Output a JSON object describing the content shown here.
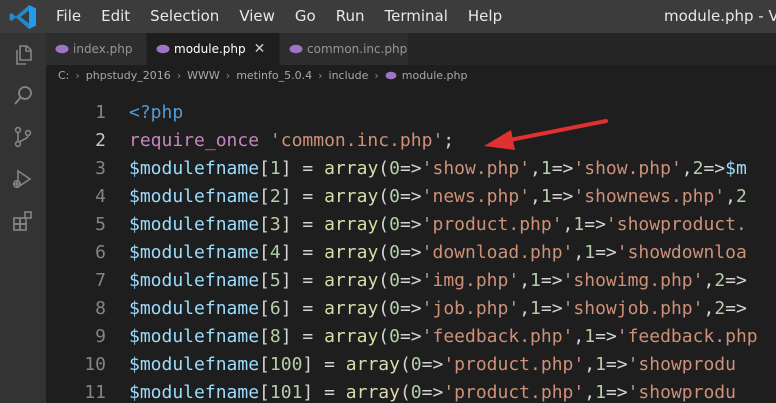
{
  "menu": [
    "File",
    "Edit",
    "Selection",
    "View",
    "Go",
    "Run",
    "Terminal",
    "Help"
  ],
  "window_title": "module.php - Vis",
  "tabs": [
    {
      "label": "index.php",
      "active": false
    },
    {
      "label": "module.php",
      "active": true
    },
    {
      "label": "common.inc.php",
      "active": false
    }
  ],
  "tab_close_glyph": "✕",
  "breadcrumb": [
    "C:",
    "phpstudy_2016",
    "WWW",
    "metinfo_5.0.4",
    "include",
    "module.php"
  ],
  "breadcrumb_separator": "›",
  "colors": {
    "keyword": "#c586c0",
    "variable": "#9cdcfe",
    "function": "#dcdcaa",
    "string": "#ce9178",
    "number": "#b5cea8",
    "tag": "#569cd6",
    "punctuation": "#d4d4d4",
    "arrow": "#e03131",
    "php_icon": "#a074c4"
  },
  "code_lines": [
    {
      "n": "1",
      "tokens": [
        {
          "t": "<?php",
          "c": "tag"
        }
      ]
    },
    {
      "n": "2",
      "tokens": [
        {
          "t": "require_once",
          "c": "keyword"
        },
        {
          "t": " ",
          "c": "punctuation"
        },
        {
          "t": "'common.inc.php'",
          "c": "string"
        },
        {
          "t": ";",
          "c": "punctuation"
        }
      ]
    },
    {
      "n": "3",
      "tokens": [
        {
          "t": "$modulefname",
          "c": "variable"
        },
        {
          "t": "[",
          "c": "punctuation"
        },
        {
          "t": "1",
          "c": "number"
        },
        {
          "t": "] = ",
          "c": "punctuation"
        },
        {
          "t": "array",
          "c": "function"
        },
        {
          "t": "(",
          "c": "punctuation"
        },
        {
          "t": "0",
          "c": "number"
        },
        {
          "t": "=>",
          "c": "punctuation"
        },
        {
          "t": "'show.php'",
          "c": "string"
        },
        {
          "t": ",",
          "c": "punctuation"
        },
        {
          "t": "1",
          "c": "number"
        },
        {
          "t": "=>",
          "c": "punctuation"
        },
        {
          "t": "'show.php'",
          "c": "string"
        },
        {
          "t": ",",
          "c": "punctuation"
        },
        {
          "t": "2",
          "c": "number"
        },
        {
          "t": "=>",
          "c": "punctuation"
        },
        {
          "t": "$m",
          "c": "variable"
        }
      ]
    },
    {
      "n": "4",
      "tokens": [
        {
          "t": "$modulefname",
          "c": "variable"
        },
        {
          "t": "[",
          "c": "punctuation"
        },
        {
          "t": "2",
          "c": "number"
        },
        {
          "t": "] = ",
          "c": "punctuation"
        },
        {
          "t": "array",
          "c": "function"
        },
        {
          "t": "(",
          "c": "punctuation"
        },
        {
          "t": "0",
          "c": "number"
        },
        {
          "t": "=>",
          "c": "punctuation"
        },
        {
          "t": "'news.php'",
          "c": "string"
        },
        {
          "t": ",",
          "c": "punctuation"
        },
        {
          "t": "1",
          "c": "number"
        },
        {
          "t": "=>",
          "c": "punctuation"
        },
        {
          "t": "'shownews.php'",
          "c": "string"
        },
        {
          "t": ",",
          "c": "punctuation"
        },
        {
          "t": "2",
          "c": "number"
        }
      ]
    },
    {
      "n": "5",
      "tokens": [
        {
          "t": "$modulefname",
          "c": "variable"
        },
        {
          "t": "[",
          "c": "punctuation"
        },
        {
          "t": "3",
          "c": "number"
        },
        {
          "t": "] = ",
          "c": "punctuation"
        },
        {
          "t": "array",
          "c": "function"
        },
        {
          "t": "(",
          "c": "punctuation"
        },
        {
          "t": "0",
          "c": "number"
        },
        {
          "t": "=>",
          "c": "punctuation"
        },
        {
          "t": "'product.php'",
          "c": "string"
        },
        {
          "t": ",",
          "c": "punctuation"
        },
        {
          "t": "1",
          "c": "number"
        },
        {
          "t": "=>",
          "c": "punctuation"
        },
        {
          "t": "'showproduct.",
          "c": "string"
        }
      ]
    },
    {
      "n": "6",
      "tokens": [
        {
          "t": "$modulefname",
          "c": "variable"
        },
        {
          "t": "[",
          "c": "punctuation"
        },
        {
          "t": "4",
          "c": "number"
        },
        {
          "t": "] = ",
          "c": "punctuation"
        },
        {
          "t": "array",
          "c": "function"
        },
        {
          "t": "(",
          "c": "punctuation"
        },
        {
          "t": "0",
          "c": "number"
        },
        {
          "t": "=>",
          "c": "punctuation"
        },
        {
          "t": "'download.php'",
          "c": "string"
        },
        {
          "t": ",",
          "c": "punctuation"
        },
        {
          "t": "1",
          "c": "number"
        },
        {
          "t": "=>",
          "c": "punctuation"
        },
        {
          "t": "'showdownloa",
          "c": "string"
        }
      ]
    },
    {
      "n": "7",
      "tokens": [
        {
          "t": "$modulefname",
          "c": "variable"
        },
        {
          "t": "[",
          "c": "punctuation"
        },
        {
          "t": "5",
          "c": "number"
        },
        {
          "t": "] = ",
          "c": "punctuation"
        },
        {
          "t": "array",
          "c": "function"
        },
        {
          "t": "(",
          "c": "punctuation"
        },
        {
          "t": "0",
          "c": "number"
        },
        {
          "t": "=>",
          "c": "punctuation"
        },
        {
          "t": "'img.php'",
          "c": "string"
        },
        {
          "t": ",",
          "c": "punctuation"
        },
        {
          "t": "1",
          "c": "number"
        },
        {
          "t": "=>",
          "c": "punctuation"
        },
        {
          "t": "'showimg.php'",
          "c": "string"
        },
        {
          "t": ",",
          "c": "punctuation"
        },
        {
          "t": "2",
          "c": "number"
        },
        {
          "t": "=>",
          "c": "punctuation"
        }
      ]
    },
    {
      "n": "8",
      "tokens": [
        {
          "t": "$modulefname",
          "c": "variable"
        },
        {
          "t": "[",
          "c": "punctuation"
        },
        {
          "t": "6",
          "c": "number"
        },
        {
          "t": "] = ",
          "c": "punctuation"
        },
        {
          "t": "array",
          "c": "function"
        },
        {
          "t": "(",
          "c": "punctuation"
        },
        {
          "t": "0",
          "c": "number"
        },
        {
          "t": "=>",
          "c": "punctuation"
        },
        {
          "t": "'job.php'",
          "c": "string"
        },
        {
          "t": ",",
          "c": "punctuation"
        },
        {
          "t": "1",
          "c": "number"
        },
        {
          "t": "=>",
          "c": "punctuation"
        },
        {
          "t": "'showjob.php'",
          "c": "string"
        },
        {
          "t": ",",
          "c": "punctuation"
        },
        {
          "t": "2",
          "c": "number"
        },
        {
          "t": "=>",
          "c": "punctuation"
        }
      ]
    },
    {
      "n": "9",
      "tokens": [
        {
          "t": "$modulefname",
          "c": "variable"
        },
        {
          "t": "[",
          "c": "punctuation"
        },
        {
          "t": "8",
          "c": "number"
        },
        {
          "t": "] = ",
          "c": "punctuation"
        },
        {
          "t": "array",
          "c": "function"
        },
        {
          "t": "(",
          "c": "punctuation"
        },
        {
          "t": "0",
          "c": "number"
        },
        {
          "t": "=>",
          "c": "punctuation"
        },
        {
          "t": "'feedback.php'",
          "c": "string"
        },
        {
          "t": ",",
          "c": "punctuation"
        },
        {
          "t": "1",
          "c": "number"
        },
        {
          "t": "=>",
          "c": "punctuation"
        },
        {
          "t": "'feedback.php",
          "c": "string"
        }
      ]
    },
    {
      "n": "10",
      "tokens": [
        {
          "t": "$modulefname",
          "c": "variable"
        },
        {
          "t": "[",
          "c": "punctuation"
        },
        {
          "t": "100",
          "c": "number"
        },
        {
          "t": "] = ",
          "c": "punctuation"
        },
        {
          "t": "array",
          "c": "function"
        },
        {
          "t": "(",
          "c": "punctuation"
        },
        {
          "t": "0",
          "c": "number"
        },
        {
          "t": "=>",
          "c": "punctuation"
        },
        {
          "t": "'product.php'",
          "c": "string"
        },
        {
          "t": ",",
          "c": "punctuation"
        },
        {
          "t": "1",
          "c": "number"
        },
        {
          "t": "=>",
          "c": "punctuation"
        },
        {
          "t": "'showprodu",
          "c": "string"
        }
      ]
    },
    {
      "n": "11",
      "tokens": [
        {
          "t": "$modulefname",
          "c": "variable"
        },
        {
          "t": "[",
          "c": "punctuation"
        },
        {
          "t": "101",
          "c": "number"
        },
        {
          "t": "] = ",
          "c": "punctuation"
        },
        {
          "t": "array",
          "c": "function"
        },
        {
          "t": "(",
          "c": "punctuation"
        },
        {
          "t": "0",
          "c": "number"
        },
        {
          "t": "=>",
          "c": "punctuation"
        },
        {
          "t": "'product.php'",
          "c": "string"
        },
        {
          "t": ",",
          "c": "punctuation"
        },
        {
          "t": "1",
          "c": "number"
        },
        {
          "t": "=>",
          "c": "punctuation"
        },
        {
          "t": "'showprodu",
          "c": "string"
        }
      ]
    }
  ]
}
